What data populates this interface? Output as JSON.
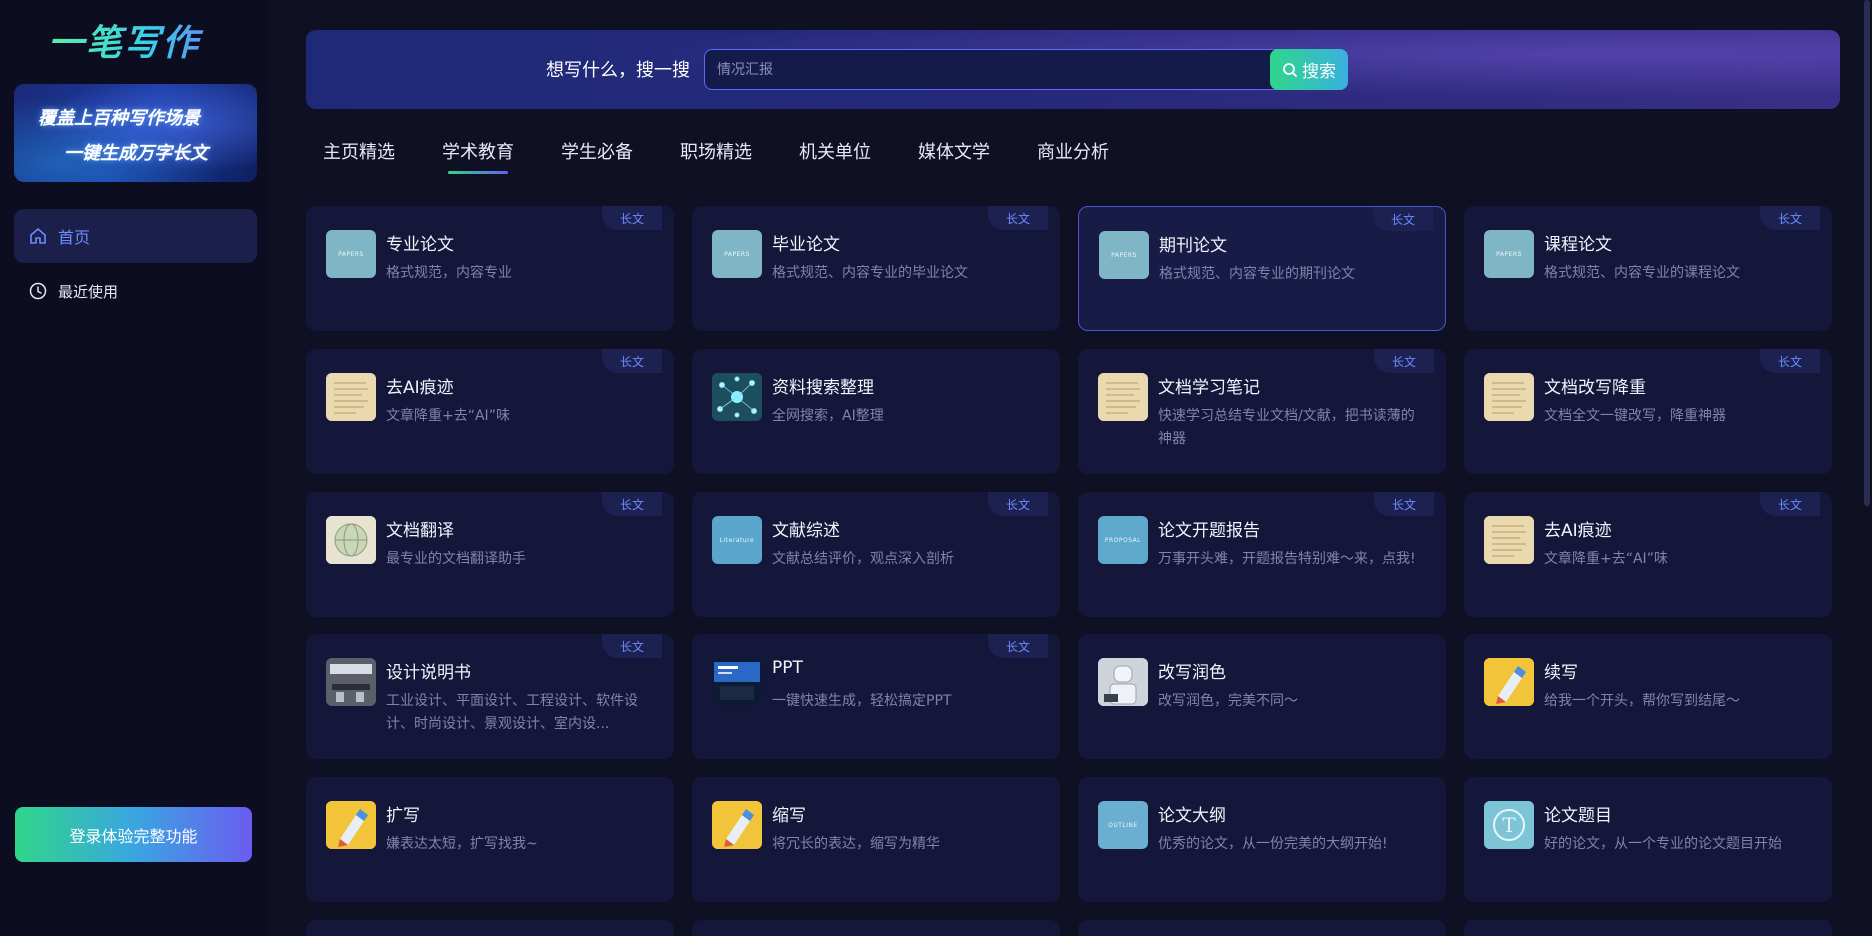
{
  "sidebar": {
    "logo": "一笔写作",
    "banner": {
      "line1": "覆盖上百种写作场景",
      "line2": "一键生成万字长文"
    },
    "nav": [
      {
        "label": "首页",
        "icon": "home-icon"
      },
      {
        "label": "最近使用",
        "icon": "clock-icon"
      }
    ],
    "login_label": "登录体验完整功能"
  },
  "search": {
    "label": "想写什么，搜一搜",
    "placeholder": "情况汇报",
    "button_label": "搜索"
  },
  "tabs": [
    "主页精选",
    "学术教育",
    "学生必备",
    "职场精选",
    "机关单位",
    "媒体文学",
    "商业分析"
  ],
  "active_tab": "学术教育",
  "badge_label": "长文",
  "cards": [
    {
      "title": "专业论文",
      "desc": "格式规范，内容专业",
      "badge": true,
      "thumb": "papers"
    },
    {
      "title": "毕业论文",
      "desc": "格式规范、内容专业的毕业论文",
      "badge": true,
      "thumb": "papers"
    },
    {
      "title": "期刊论文",
      "desc": "格式规范、内容专业的期刊论文",
      "badge": true,
      "thumb": "papers",
      "selected": true
    },
    {
      "title": "课程论文",
      "desc": "格式规范、内容专业的课程论文",
      "badge": true,
      "thumb": "papers"
    },
    {
      "title": "去AI痕迹",
      "desc": "文章降重+去“AI”味",
      "badge": true,
      "thumb": "parchment"
    },
    {
      "title": "资料搜索整理",
      "desc": "全网搜索，AI整理",
      "badge": false,
      "thumb": "network"
    },
    {
      "title": "文档学习笔记",
      "desc": "快速学习总结专业文档/文献，把书读薄的神器",
      "badge": true,
      "thumb": "parchment"
    },
    {
      "title": "文档改写降重",
      "desc": "文档全文一键改写，降重神器",
      "badge": true,
      "thumb": "parchment"
    },
    {
      "title": "文档翻译",
      "desc": "最专业的文档翻译助手",
      "badge": true,
      "thumb": "globe"
    },
    {
      "title": "文献综述",
      "desc": "文献总结评价，观点深入剖析",
      "badge": true,
      "thumb": "literature"
    },
    {
      "title": "论文开题报告",
      "desc": "万事开头难，开题报告特别难～来，点我!",
      "badge": true,
      "thumb": "proposal"
    },
    {
      "title": "去AI痕迹",
      "desc": "文章降重+去“AI”味",
      "badge": true,
      "thumb": "parchment"
    },
    {
      "title": "设计说明书",
      "desc": "工业设计、平面设计、工程设计、软件设计、时尚设计、景观设计、室内设...",
      "badge": true,
      "thumb": "office"
    },
    {
      "title": "PPT",
      "desc": "一键快速生成，轻松搞定PPT",
      "badge": true,
      "thumb": "slides"
    },
    {
      "title": "改写润色",
      "desc": "改写润色，完美不同～",
      "badge": false,
      "thumb": "robot"
    },
    {
      "title": "续写",
      "desc": "给我一个开头，帮你写到结尾～",
      "badge": false,
      "thumb": "pen"
    },
    {
      "title": "扩写",
      "desc": "嫌表达太短，扩写找我~",
      "badge": false,
      "thumb": "pen"
    },
    {
      "title": "缩写",
      "desc": "将冗长的表达，缩写为精华",
      "badge": false,
      "thumb": "pen"
    },
    {
      "title": "论文大纲",
      "desc": "优秀的论文，从一份完美的大纲开始!",
      "badge": false,
      "thumb": "outline"
    },
    {
      "title": "论文题目",
      "desc": "好的论文，从一个专业的论文题目开始",
      "badge": false,
      "thumb": "title"
    },
    {
      "title": "",
      "desc": "",
      "badge": false,
      "thumb": "none"
    },
    {
      "title": "",
      "desc": "",
      "badge": false,
      "thumb": "none"
    },
    {
      "title": "",
      "desc": "",
      "badge": false,
      "thumb": "none"
    },
    {
      "title": "",
      "desc": "",
      "badge": false,
      "thumb": "none"
    }
  ],
  "thumb_colors": {
    "papers": "#7fb6c6",
    "parchment": "#e6d3a6",
    "network": "#2a8f98",
    "globe": "#d8d2bf",
    "literature": "#5aa6cc",
    "proposal": "#5ea8cc",
    "office": "#4a4f5a",
    "slides": "#1a3a70",
    "robot": "#c8ccd4",
    "pen": "#f2c43a",
    "outline": "#6aaed0",
    "title": "#7cc4d6"
  },
  "thumb_captions": {
    "papers": "PAPERS",
    "literature": "Literature",
    "proposal": "PROPOSAL",
    "outline": "OUTLINE"
  }
}
